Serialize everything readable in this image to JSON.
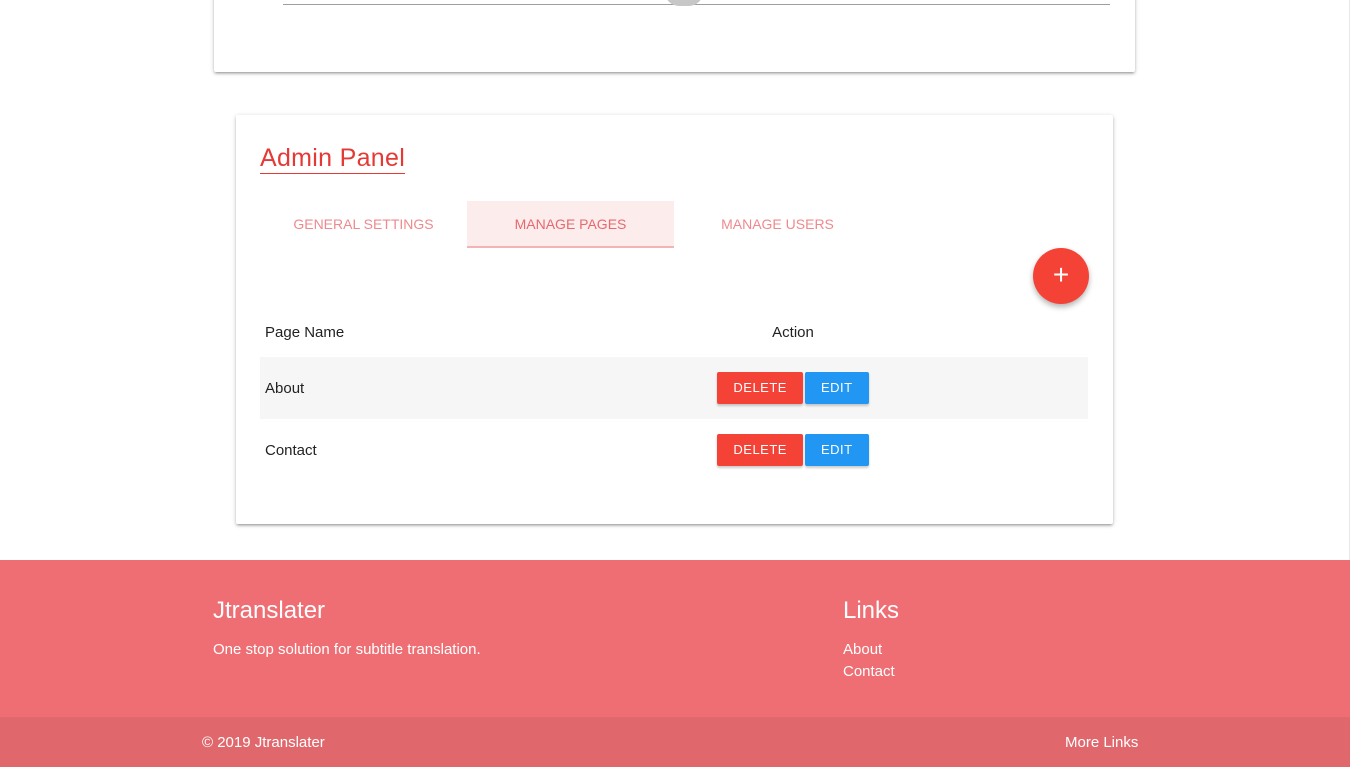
{
  "admin": {
    "title": "Admin Panel",
    "tabs": [
      {
        "label": "GENERAL SETTINGS"
      },
      {
        "label": "MANAGE PAGES",
        "active": true
      },
      {
        "label": "MANAGE USERS"
      }
    ],
    "add_label": "+",
    "table": {
      "headers": [
        "Page Name",
        "Action"
      ],
      "rows": [
        {
          "name": "About",
          "delete": "DELETE",
          "edit": "EDIT"
        },
        {
          "name": "Contact",
          "delete": "DELETE",
          "edit": "EDIT"
        }
      ]
    }
  },
  "footer": {
    "brand": "Jtranslater",
    "tagline": "One stop solution for subtitle translation.",
    "links_title": "Links",
    "links": [
      "About",
      "Contact"
    ],
    "copyright": "© 2019 Jtranslater",
    "more_links": "More Links"
  },
  "colors": {
    "accent": "#f44336",
    "edit": "#2196f3",
    "footer": "#ee6e73"
  }
}
